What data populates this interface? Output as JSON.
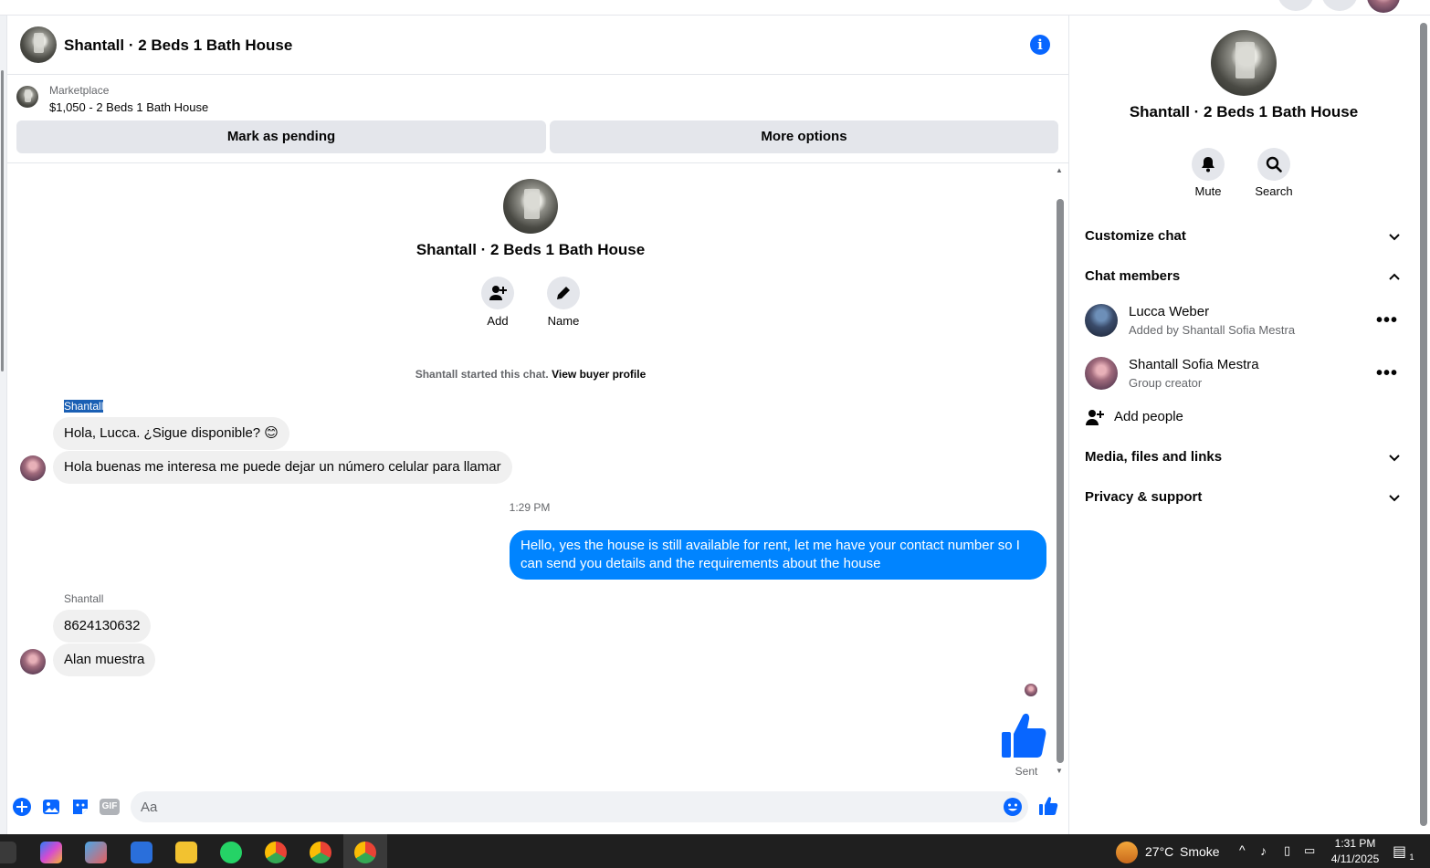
{
  "header": {
    "title": "Shantall · 2 Beds 1 Bath House"
  },
  "listing": {
    "source": "Marketplace",
    "item": "$1,050 - 2 Beds 1 Bath House",
    "mark_pending": "Mark as pending",
    "more_options": "More options"
  },
  "intro": {
    "title": "Shantall · 2 Beds 1 Bath House",
    "add_label": "Add",
    "name_label": "Name",
    "started_text": "Shantall started this chat.",
    "view_buyer": "View buyer profile"
  },
  "messages": {
    "sender1": "Shantall",
    "m1": "Hola, Lucca. ¿Sigue disponible? 😊",
    "m2": "Hola buenas me interesa me puede dejar un número celular para llamar",
    "timestamp": "1:29 PM",
    "m3": "Hello, yes the house is still available for rent, let me have your contact number so I can send you details and the requirements about the house",
    "sender2": "Shantall",
    "m4": "8624130632",
    "m5": "Alan muestra",
    "sent_status": "Sent"
  },
  "composer": {
    "placeholder": "Aa",
    "gif_label": "GIF"
  },
  "right_panel": {
    "title": "Shantall · 2 Beds 1 Bath House",
    "mute_label": "Mute",
    "search_label": "Search",
    "customize_chat": "Customize chat",
    "chat_members": "Chat members",
    "members": [
      {
        "name": "Lucca Weber",
        "sub": "Added by Shantall Sofia Mestra"
      },
      {
        "name": "Shantall Sofia Mestra",
        "sub": "Group creator"
      }
    ],
    "add_people": "Add people",
    "media_files": "Media, files and links",
    "privacy_support": "Privacy & support"
  },
  "taskbar": {
    "weather_temp": "27°C",
    "weather_cond": "Smoke",
    "time": "1:31 PM",
    "date": "4/11/2025",
    "notif_count": "1"
  },
  "colors": {
    "accent": "#0866ff",
    "my_bubble": "#0084ff",
    "their_bubble": "#f0f0f0",
    "button_grey": "#e4e6eb",
    "taskbar": "#1f1f1f"
  }
}
